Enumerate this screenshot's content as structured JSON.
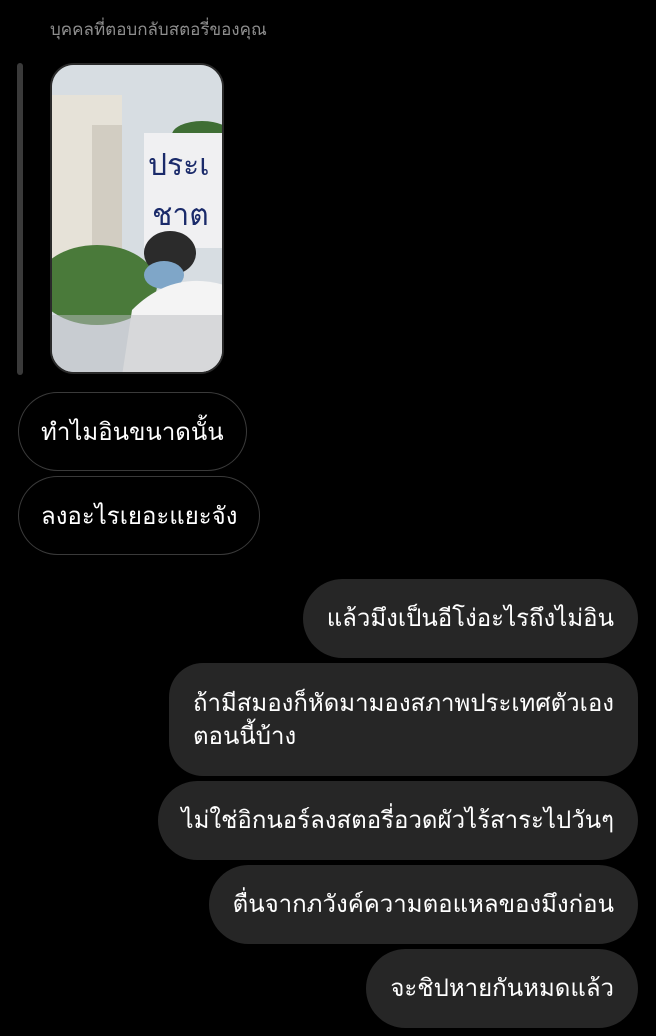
{
  "reply_header": "บุคคลที่ตอบกลับสตอรี่ของคุณ",
  "story": {
    "sign_text_line1": "ประเ",
    "sign_text_line2": "ชาต"
  },
  "incoming": [
    "ทำไมอินขนาดนั้น",
    "ลงอะไรเยอะแยะจัง"
  ],
  "outgoing": [
    "แล้วมึงเป็นอีโง่อะไรถึงไม่อิน",
    "ถ้ามีสมองก็หัดมามองสภาพประเทศตัวเอง\nตอนนี้บ้าง",
    "ไม่ใช่อิกนอร์ลงสตอรี่อวดผัวไร้สาระไปวันๆ",
    "ตื่นจากภวังค์ความตอแหลของมึงก่อน",
    "จะชิปหายกันหมดแล้ว"
  ],
  "colors": {
    "background": "#000000",
    "bubble_out": "#262626",
    "bubble_in_border": "#3a3a3a",
    "muted_text": "#8e8e8e"
  }
}
